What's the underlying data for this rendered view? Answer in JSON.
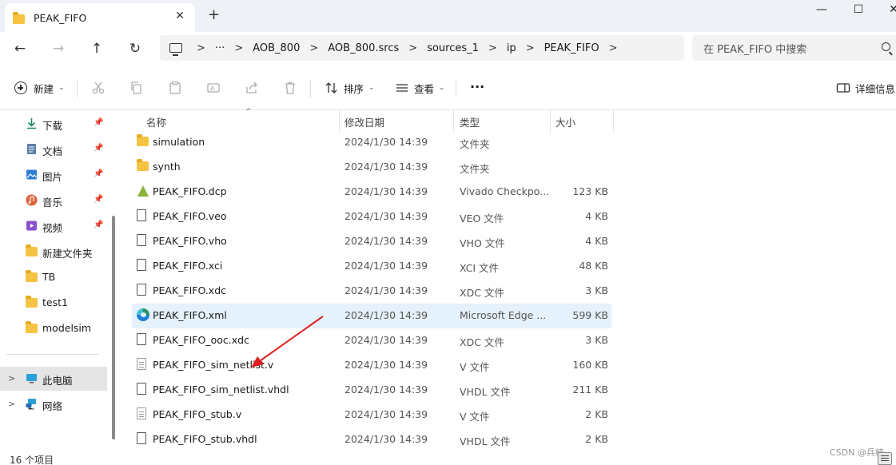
{
  "window": {
    "tab_title": "PEAK_FIFO",
    "close_glyph": "✕",
    "new_tab_glyph": "+",
    "minimize_glyph": "—",
    "maximize_glyph": "☐",
    "close_window_glyph": "✕"
  },
  "nav": {
    "back_glyph": "←",
    "forward_glyph": "→",
    "up_glyph": "↑",
    "refresh_glyph": "↻"
  },
  "address": {
    "overflow": "···",
    "crumbs": [
      "AOB_800",
      "AOB_800.srcs",
      "sources_1",
      "ip",
      "PEAK_FIFO"
    ],
    "separator": ">"
  },
  "search": {
    "placeholder": "在 PEAK_FIFO 中搜索"
  },
  "toolbar": {
    "new_label": "新建",
    "sort_label": "排序",
    "view_label": "查看",
    "more_label": "···",
    "details_label": "详细信息"
  },
  "sidebar": {
    "quick": [
      {
        "label": "下载",
        "icon": "download-icon",
        "pinned": true
      },
      {
        "label": "文档",
        "icon": "document-icon",
        "pinned": true
      },
      {
        "label": "图片",
        "icon": "pictures-icon",
        "pinned": true
      },
      {
        "label": "音乐",
        "icon": "music-icon",
        "pinned": true
      },
      {
        "label": "视频",
        "icon": "video-icon",
        "pinned": true
      },
      {
        "label": "新建文件夹",
        "icon": "folder-icon",
        "pinned": false
      },
      {
        "label": "TB",
        "icon": "folder-icon",
        "pinned": false
      },
      {
        "label": "test1",
        "icon": "folder-icon",
        "pinned": false
      },
      {
        "label": "modelsim",
        "icon": "folder-icon",
        "pinned": false
      }
    ],
    "this_pc": "此电脑",
    "network": "网络"
  },
  "columns": {
    "name": "名称",
    "date": "修改日期",
    "type": "类型",
    "size": "大小"
  },
  "files": [
    {
      "name": "simulation",
      "date": "2024/1/30 14:39",
      "type": "文件夹",
      "size": "",
      "icon": "folder-icon"
    },
    {
      "name": "synth",
      "date": "2024/1/30 14:39",
      "type": "文件夹",
      "size": "",
      "icon": "folder-icon"
    },
    {
      "name": "PEAK_FIFO.dcp",
      "date": "2024/1/30 14:39",
      "type": "Vivado Checkpo...",
      "size": "123 KB",
      "icon": "vivado-icon"
    },
    {
      "name": "PEAK_FIFO.veo",
      "date": "2024/1/30 14:39",
      "type": "VEO 文件",
      "size": "4 KB",
      "icon": "file-icon"
    },
    {
      "name": "PEAK_FIFO.vho",
      "date": "2024/1/30 14:39",
      "type": "VHO 文件",
      "size": "4 KB",
      "icon": "file-icon"
    },
    {
      "name": "PEAK_FIFO.xci",
      "date": "2024/1/30 14:39",
      "type": "XCI 文件",
      "size": "48 KB",
      "icon": "file-icon"
    },
    {
      "name": "PEAK_FIFO.xdc",
      "date": "2024/1/30 14:39",
      "type": "XDC 文件",
      "size": "3 KB",
      "icon": "file-icon"
    },
    {
      "name": "PEAK_FIFO.xml",
      "date": "2024/1/30 14:39",
      "type": "Microsoft Edge ...",
      "size": "599 KB",
      "icon": "edge-icon"
    },
    {
      "name": "PEAK_FIFO_ooc.xdc",
      "date": "2024/1/30 14:39",
      "type": "XDC 文件",
      "size": "3 KB",
      "icon": "file-icon"
    },
    {
      "name": "PEAK_FIFO_sim_netlist.v",
      "date": "2024/1/30 14:39",
      "type": "V 文件",
      "size": "160 KB",
      "icon": "text-file-icon"
    },
    {
      "name": "PEAK_FIFO_sim_netlist.vhdl",
      "date": "2024/1/30 14:39",
      "type": "VHDL 文件",
      "size": "211 KB",
      "icon": "file-icon"
    },
    {
      "name": "PEAK_FIFO_stub.v",
      "date": "2024/1/30 14:39",
      "type": "V 文件",
      "size": "2 KB",
      "icon": "text-file-icon"
    },
    {
      "name": "PEAK_FIFO_stub.vhdl",
      "date": "2024/1/30 14:39",
      "type": "VHDL 文件",
      "size": "2 KB",
      "icon": "file-icon"
    }
  ],
  "status": {
    "item_count": "16 个项目",
    "watermark": "CSDN @兵楠"
  },
  "colors": {
    "selection": "#e5f1fb",
    "folder": "#f5c342",
    "annotation": "#e02020"
  }
}
